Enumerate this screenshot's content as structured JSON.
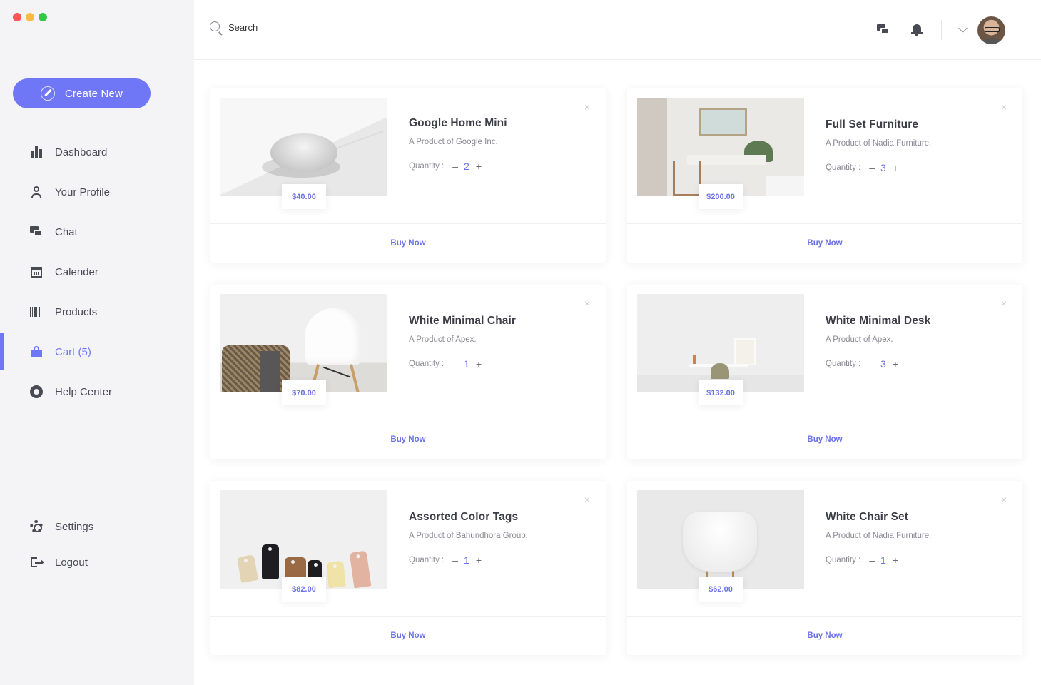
{
  "window": {
    "controls": [
      "close",
      "minimize",
      "maximize"
    ]
  },
  "sidebar": {
    "create_button": "Create New",
    "items": [
      {
        "label": "Dashboard",
        "icon": "bar-chart-icon"
      },
      {
        "label": "Your Profile",
        "icon": "user-icon"
      },
      {
        "label": "Chat",
        "icon": "chat-icon"
      },
      {
        "label": "Calender",
        "icon": "calendar-icon"
      },
      {
        "label": "Products",
        "icon": "barcode-icon"
      },
      {
        "label": "Cart (5)",
        "icon": "shopping-bag-icon",
        "active": true
      },
      {
        "label": "Help Center",
        "icon": "lifebuoy-icon"
      }
    ],
    "bottom_items": [
      {
        "label": "Settings",
        "icon": "gear-icon"
      },
      {
        "label": "Logout",
        "icon": "logout-icon"
      }
    ]
  },
  "header": {
    "search": {
      "placeholder": "Search",
      "value": ""
    },
    "icons": [
      "chat-icon",
      "bell-icon",
      "chevron-down-icon",
      "avatar"
    ]
  },
  "cart": {
    "quantity_label": "Quantity :",
    "buy_label": "Buy Now",
    "close_symbol": "×",
    "minus_symbol": "–",
    "plus_symbol": "+",
    "products": [
      {
        "title": "Google Home Mini",
        "subtitle": "A Product of Google Inc.",
        "quantity": "2",
        "price": "$40.00",
        "image": "google-home-mini"
      },
      {
        "title": "Full Set Furniture",
        "subtitle": "A Product of Nadia Furniture.",
        "quantity": "3",
        "price": "$200.00",
        "image": "furniture-set"
      },
      {
        "title": "White Minimal Chair",
        "subtitle": "A Product of Apex.",
        "quantity": "1",
        "price": "$70.00",
        "image": "white-chair"
      },
      {
        "title": "White Minimal Desk",
        "subtitle": "A Product of Apex.",
        "quantity": "3",
        "price": "$132.00",
        "image": "white-desk"
      },
      {
        "title": "Assorted Color Tags",
        "subtitle": "A Product of Bahundhora Group.",
        "quantity": "1",
        "price": "$82.00",
        "image": "color-tags"
      },
      {
        "title": "White Chair Set",
        "subtitle": "A Product of Nadia Furniture.",
        "quantity": "1",
        "price": "$62.00",
        "image": "white-chair-set"
      }
    ]
  },
  "colors": {
    "accent": "#7077f6",
    "sidebar_bg": "#f4f4f6",
    "text": "#3d3d48",
    "muted": "#8a8a95"
  }
}
